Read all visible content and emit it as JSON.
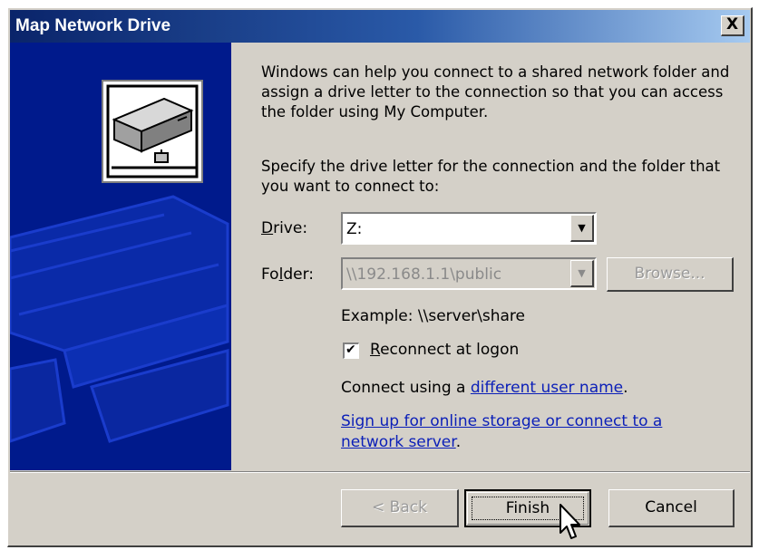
{
  "window": {
    "title": "Map Network Drive",
    "close_glyph": "X"
  },
  "intro_text": "Windows can help you connect to a shared network folder and assign a drive letter to the connection so that you can access the folder using My Computer.",
  "instruction_text": "Specify the drive letter for the connection and the folder that you want to connect to:",
  "drive": {
    "label_mnemonic": "D",
    "label_rest": "rive:",
    "value": "Z:"
  },
  "folder": {
    "label_pre": "Fo",
    "label_mnemonic": "l",
    "label_post": "der:",
    "value": "\\\\192.168.1.1\\public",
    "browse_label": "Browse..."
  },
  "example_text": "Example: \\\\server\\share",
  "reconnect": {
    "label_mnemonic": "R",
    "label_rest": "econnect at logon",
    "checked": true,
    "check_glyph": "✔"
  },
  "connect_using": {
    "prefix": "Connect using a ",
    "link": "different user name",
    "suffix": "."
  },
  "signup": {
    "line1": "Sign up for online storage or connect to a",
    "line2": "network server",
    "suffix": "."
  },
  "buttons": {
    "back": "< Back",
    "finish": "Finish",
    "cancel": "Cancel"
  },
  "icons": {
    "close": "close-icon",
    "drive": "network-drive-icon",
    "dropdown": "chevron-down-icon",
    "cursor": "mouse-pointer-icon"
  },
  "colors": {
    "title_bar": "#0a246a",
    "side_panel": "#001a8c",
    "link": "#0b1fb8",
    "face": "#d4d0c8"
  }
}
